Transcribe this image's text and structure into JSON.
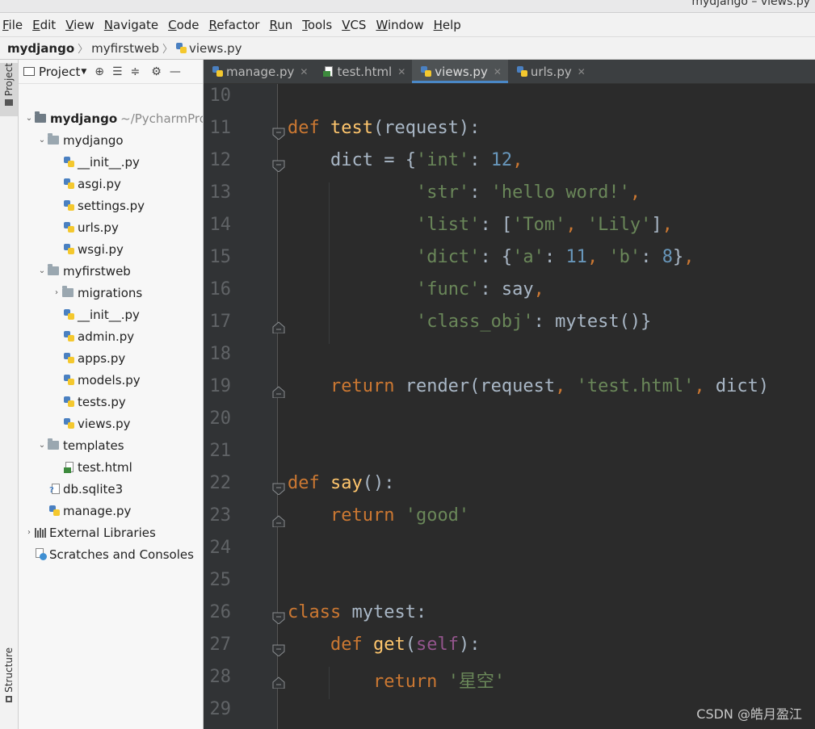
{
  "window": {
    "title": "mydjango – views.py"
  },
  "menu": [
    "File",
    "Edit",
    "View",
    "Navigate",
    "Code",
    "Refactor",
    "Run",
    "Tools",
    "VCS",
    "Window",
    "Help"
  ],
  "breadcrumb": [
    "mydjango",
    "myfirstweb",
    "views.py"
  ],
  "side_tabs": {
    "project": "Project",
    "structure": "Structure"
  },
  "project_panel": {
    "header": "Project",
    "tree": [
      {
        "label": "mydjango",
        "hint": "~/PycharmProj",
        "kind": "root"
      },
      {
        "label": "mydjango",
        "kind": "folder"
      },
      {
        "label": "__init__.py",
        "kind": "py"
      },
      {
        "label": "asgi.py",
        "kind": "py"
      },
      {
        "label": "settings.py",
        "kind": "py"
      },
      {
        "label": "urls.py",
        "kind": "py"
      },
      {
        "label": "wsgi.py",
        "kind": "py"
      },
      {
        "label": "myfirstweb",
        "kind": "folder"
      },
      {
        "label": "migrations",
        "kind": "folder"
      },
      {
        "label": "__init__.py",
        "kind": "py"
      },
      {
        "label": "admin.py",
        "kind": "py"
      },
      {
        "label": "apps.py",
        "kind": "py"
      },
      {
        "label": "models.py",
        "kind": "py"
      },
      {
        "label": "tests.py",
        "kind": "py"
      },
      {
        "label": "views.py",
        "kind": "py"
      },
      {
        "label": "templates",
        "kind": "folder"
      },
      {
        "label": "test.html",
        "kind": "html"
      },
      {
        "label": "db.sqlite3",
        "kind": "db"
      },
      {
        "label": "manage.py",
        "kind": "py"
      },
      {
        "label": "External Libraries",
        "kind": "lib"
      },
      {
        "label": "Scratches and Consoles",
        "kind": "scratch"
      }
    ]
  },
  "editor_tabs": [
    {
      "label": "manage.py",
      "active": false
    },
    {
      "label": "test.html",
      "active": false
    },
    {
      "label": "views.py",
      "active": true
    },
    {
      "label": "urls.py",
      "active": false
    }
  ],
  "code": {
    "line_numbers": [
      "10",
      "11",
      "12",
      "13",
      "14",
      "15",
      "16",
      "17",
      "18",
      "19",
      "20",
      "21",
      "22",
      "23",
      "24",
      "25",
      "26",
      "27",
      "28",
      "29"
    ],
    "lines": [
      [],
      [
        [
          "kw",
          "def "
        ],
        [
          "fn",
          "test"
        ],
        [
          "p",
          "(request):"
        ]
      ],
      [
        [
          "p",
          "    dict = {"
        ],
        [
          "str",
          "'int'"
        ],
        [
          "p",
          ": "
        ],
        [
          "num",
          "12"
        ],
        [
          "kw",
          ","
        ]
      ],
      [
        [
          "p",
          "            "
        ],
        [
          "str",
          "'str'"
        ],
        [
          "p",
          ": "
        ],
        [
          "str",
          "'hello word!'"
        ],
        [
          "kw",
          ","
        ]
      ],
      [
        [
          "p",
          "            "
        ],
        [
          "str",
          "'list'"
        ],
        [
          "p",
          ": ["
        ],
        [
          "str",
          "'Tom'"
        ],
        [
          "kw",
          ", "
        ],
        [
          "str",
          "'Lily'"
        ],
        [
          "p",
          "]"
        ],
        [
          "kw",
          ","
        ]
      ],
      [
        [
          "p",
          "            "
        ],
        [
          "str",
          "'dict'"
        ],
        [
          "p",
          ": {"
        ],
        [
          "str",
          "'a'"
        ],
        [
          "p",
          ": "
        ],
        [
          "num",
          "11"
        ],
        [
          "kw",
          ", "
        ],
        [
          "str",
          "'b'"
        ],
        [
          "p",
          ": "
        ],
        [
          "num",
          "8"
        ],
        [
          "p",
          "}"
        ],
        [
          "kw",
          ","
        ]
      ],
      [
        [
          "p",
          "            "
        ],
        [
          "str",
          "'func'"
        ],
        [
          "p",
          ": say"
        ],
        [
          "kw",
          ","
        ]
      ],
      [
        [
          "p",
          "            "
        ],
        [
          "str",
          "'class_obj'"
        ],
        [
          "p",
          ": mytest()}"
        ]
      ],
      [],
      [
        [
          "kw",
          "    return "
        ],
        [
          "p",
          "render(request"
        ],
        [
          "kw",
          ", "
        ],
        [
          "str",
          "'test.html'"
        ],
        [
          "kw",
          ", "
        ],
        [
          "p",
          "dict)"
        ]
      ],
      [],
      [],
      [
        [
          "kw",
          "def "
        ],
        [
          "fn",
          "say"
        ],
        [
          "p",
          "():"
        ]
      ],
      [
        [
          "kw",
          "    return "
        ],
        [
          "str",
          "'good'"
        ]
      ],
      [],
      [],
      [
        [
          "kw",
          "class "
        ],
        [
          "p",
          "mytest:"
        ]
      ],
      [
        [
          "kw",
          "    def "
        ],
        [
          "fn",
          "get"
        ],
        [
          "p",
          "("
        ],
        [
          "self",
          "self"
        ],
        [
          "p",
          "):"
        ]
      ],
      [
        [
          "kw",
          "        return "
        ],
        [
          "str",
          "'星空'"
        ]
      ],
      []
    ]
  },
  "watermark": "CSDN @皓月盈江"
}
